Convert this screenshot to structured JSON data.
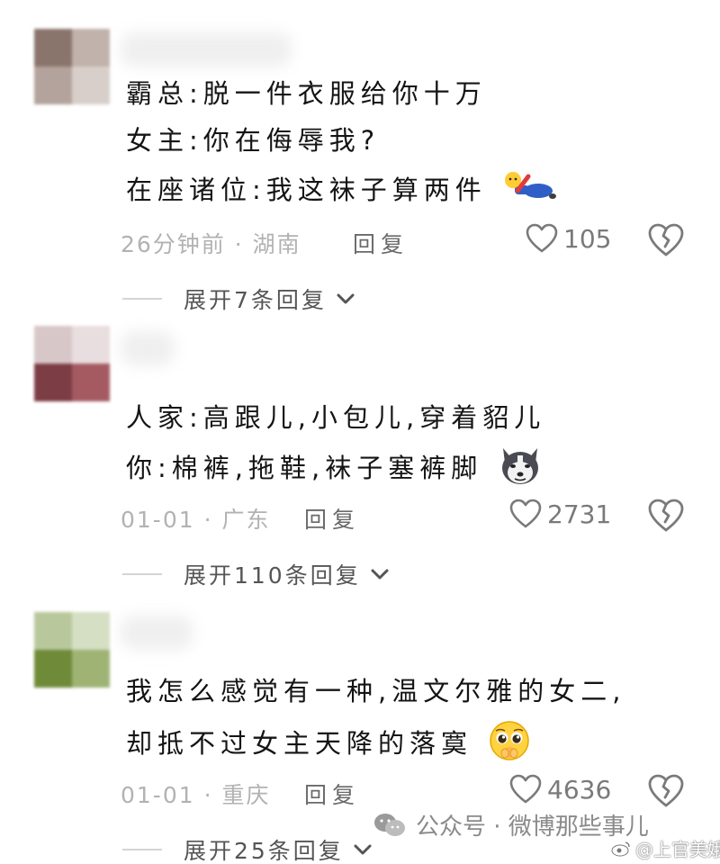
{
  "comments": [
    {
      "lines": [
        "霸总:脱一件衣服给你十万",
        "女主:你在侮辱我?",
        "在座诸位:我这袜子算两件"
      ],
      "emoji": "lying-flat-emoji",
      "time": "26分钟前",
      "separator": "·",
      "location": "湖南",
      "reply_label": "回复",
      "likes": "105",
      "expand_label": "展开7条回复"
    },
    {
      "lines": [
        "人家:高跟儿,小包儿,穿着貂儿",
        "你:棉裤,拖鞋,袜子塞裤脚"
      ],
      "emoji": "husky-dog-emoji",
      "time": "01-01",
      "separator": "·",
      "location": "广东",
      "reply_label": "回复",
      "likes": "2731",
      "expand_label": "展开110条回复"
    },
    {
      "lines": [
        "我怎么感觉有一种,温文尔雅的女二,",
        "却抵不过女主天降的落寞"
      ],
      "emoji": "pleading-face-emoji",
      "time": "01-01",
      "separator": "·",
      "location": "重庆",
      "reply_label": "回复",
      "likes": "4636",
      "expand_label": "展开25条回复"
    }
  ],
  "watermark": {
    "wechat_text": "公众号 · 微博那些事儿",
    "weibo_text": "@上官美娥"
  },
  "icons": {
    "like": "heart-outline-icon",
    "dislike": "broken-heart-icon",
    "expand": "chevron-down-icon",
    "wechat": "wechat-icon",
    "weibo": "weibo-icon"
  },
  "colors": {
    "text": "#141414",
    "meta": "#b2b2b2",
    "icon": "#7a7a7a",
    "avatar1": [
      "#8a756c",
      "#c1b2ab",
      "#b3a39c",
      "#d8cfca"
    ],
    "avatar2": [
      "#d7c7c8",
      "#e9dedf",
      "#7c3d44",
      "#a55a62"
    ],
    "avatar3": [
      "#b9c89c",
      "#d5dfc3",
      "#6f8a38",
      "#9fb375"
    ]
  }
}
